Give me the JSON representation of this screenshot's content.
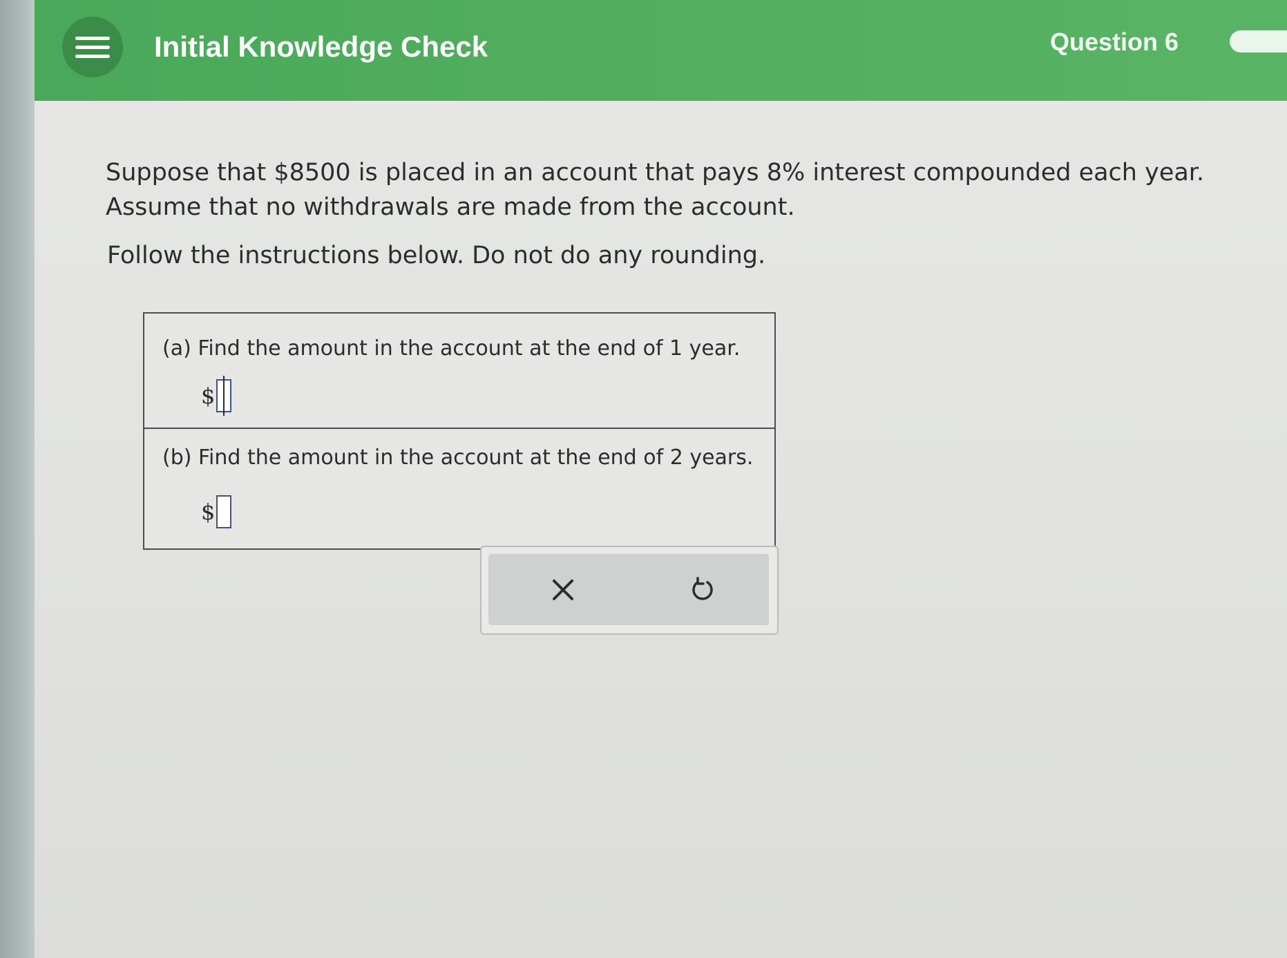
{
  "header": {
    "title": "Initial Knowledge Check",
    "question_label": "Question 6"
  },
  "problem": {
    "line1": "Suppose that $8500 is placed in an account that pays 8% interest compounded each year.",
    "line2": "Assume that no withdrawals are made from the account.",
    "instruction": "Follow the instructions below. Do not do any rounding."
  },
  "parts": [
    {
      "label": "(a) Find the amount in the account at the end of 1 year.",
      "currency": "$",
      "value": ""
    },
    {
      "label": "(b) Find the amount in the account at the end of 2 years.",
      "currency": "$",
      "value": ""
    }
  ],
  "actions": {
    "clear_icon": "x-icon",
    "undo_icon": "undo-icon"
  },
  "colors": {
    "header_green": "#52b05f",
    "menu_button": "#3a8c48",
    "text": "#2a2d2e"
  }
}
